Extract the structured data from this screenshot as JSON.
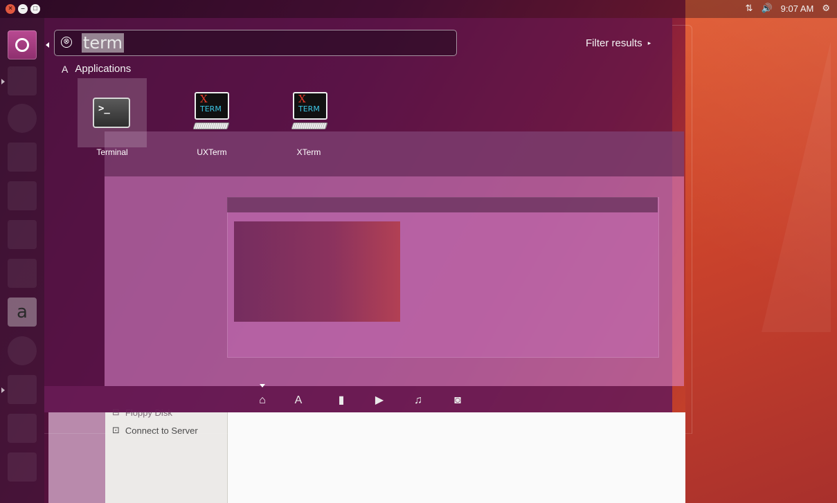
{
  "window_controls": {
    "close": "×",
    "minimize": "–",
    "maximize": "□"
  },
  "panel": {
    "network_icon": "network-arrows-icon",
    "volume_icon": "volume-icon",
    "time": "9:07 AM",
    "power_icon": "power-gear-icon",
    "glyphs": {
      "network": "⇅",
      "volume": "🔊",
      "power": "⚙"
    }
  },
  "launcher": {
    "items": [
      "ubuntu-dash",
      "files",
      "firefox",
      "writer",
      "calc",
      "impress",
      "software-center",
      "amazon",
      "system-settings",
      "screenshot",
      "terminal",
      "floppy"
    ],
    "amazon_glyph": "a"
  },
  "dash": {
    "search": {
      "value": "term",
      "clear_glyph": "⊗"
    },
    "filter_label": "Filter results",
    "filter_arrow": "▸",
    "category": {
      "label": "Applications",
      "glyph": "A"
    },
    "apps": [
      {
        "label": "Terminal",
        "prompt": ">_"
      },
      {
        "label": "UXTerm",
        "x": "X",
        "term": "TERM"
      },
      {
        "label": "XTerm",
        "x": "X",
        "term": "TERM"
      }
    ],
    "lenses": [
      {
        "name": "home",
        "glyph": "⌂"
      },
      {
        "name": "applications",
        "glyph": "A"
      },
      {
        "name": "files",
        "glyph": "▮"
      },
      {
        "name": "video",
        "glyph": "▶"
      },
      {
        "name": "music",
        "glyph": "♫"
      },
      {
        "name": "photos",
        "glyph": "◙"
      }
    ]
  },
  "background_window": {
    "sidebar_items": [
      {
        "label": "Floppy Disk",
        "glyph": "⊟"
      },
      {
        "label": "Connect to Server",
        "glyph": "⊡"
      }
    ]
  },
  "colors": {
    "accent": "#8e2f6e",
    "close": "#e0583f",
    "dash_bg": "#5a144b"
  }
}
